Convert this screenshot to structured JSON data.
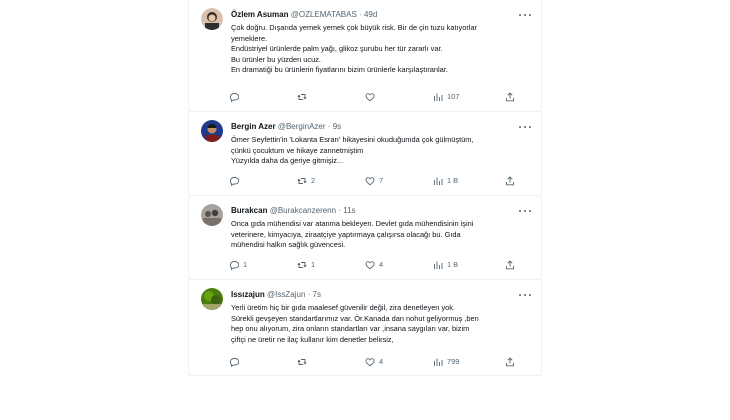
{
  "tweets": [
    {
      "name": "Özlem Asuman",
      "handle": "@OZLEMATABAS",
      "separator": "·",
      "time": "49d",
      "avatar": "avatar-photo-woman",
      "lines": [
        "Çok doğru. Dışarıda yemek yemek çok büyük risk. Bir de çin tuzu katıyorlar",
        "yemeklere.",
        "Endüstriyel ürünlerde palm yağı, glikoz şurubu her tür zararlı var.",
        "Bu ürünler bu yüzden ucuz.",
        "En dramatiği bu ürünlerin fiyatlarını bizim ürünlerle karşılaştıranlar."
      ],
      "reply_count": "",
      "retweet_count": "",
      "like_count": "",
      "view_count": "107"
    },
    {
      "name": "Bergin Azer",
      "handle": "@BerginAzer",
      "separator": "·",
      "time": "9s",
      "avatar": "avatar-photo-man",
      "lines": [
        "Ömer Seyfettin'in 'Lokanta Esrarı' hikayesini okuduğumda çok gülmüştüm,",
        "çünkü çocuktum ve hikaye zannetmiştim",
        "Yüzyılda daha da geriye gitmişiz..."
      ],
      "reply_count": "",
      "retweet_count": "2",
      "like_count": "7",
      "view_count": "1 B"
    },
    {
      "name": "Burakcan",
      "handle": "@Burakcanzerenn",
      "separator": "·",
      "time": "11s",
      "avatar": "avatar-photo-group",
      "lines": [
        "Onca gıda mühendisi var atanma bekleyen. Devlet gıda mühendisinin işini",
        "veterinere, kimyacıya, ziraatçiye yaptırmaya çalışırsa olacağı bu. Gıda",
        "mühendisi halkın sağlık güvencesi."
      ],
      "reply_count": "1",
      "retweet_count": "1",
      "like_count": "4",
      "view_count": "1 B"
    },
    {
      "name": "Issızajun",
      "handle": "@IssZajun",
      "separator": "·",
      "time": "7s",
      "avatar": "avatar-photo-nature",
      "lines": [
        "Yerli üretim hiç bir gıda maalesef güvenilir değil, zira denetleyen yok.",
        "Sürekli gevşeyen standartlarımız var. Ör.Kanada dan nohut geliyormuş ,ben",
        "hep onu alıyorum, zira onların standartları var ,insana saygıları var, bizim",
        "çiftçi ne üretir ne ilaç kullanır kim denetler belirsiz,"
      ],
      "reply_count": "",
      "retweet_count": "",
      "like_count": "4",
      "view_count": "799"
    }
  ],
  "icons": {
    "reply": "reply-icon",
    "retweet": "retweet-icon",
    "like": "heart-icon",
    "views": "views-icon",
    "share": "share-icon",
    "more": "more-icon"
  },
  "colors": {
    "text": "#0f1419",
    "secondary": "#536471",
    "border": "#eff3f4"
  }
}
